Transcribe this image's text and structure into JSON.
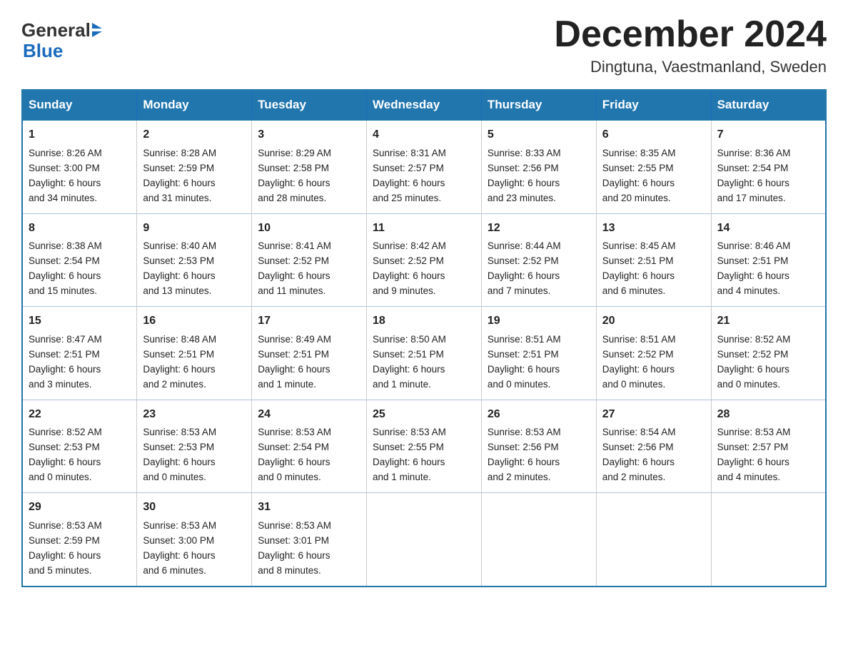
{
  "header": {
    "logo_general": "General",
    "logo_blue": "Blue",
    "month_title": "December 2024",
    "location": "Dingtuna, Vaestmanland, Sweden"
  },
  "columns": [
    "Sunday",
    "Monday",
    "Tuesday",
    "Wednesday",
    "Thursday",
    "Friday",
    "Saturday"
  ],
  "weeks": [
    [
      {
        "day": "1",
        "sunrise": "Sunrise: 8:26 AM",
        "sunset": "Sunset: 3:00 PM",
        "daylight": "Daylight: 6 hours",
        "daylight2": "and 34 minutes."
      },
      {
        "day": "2",
        "sunrise": "Sunrise: 8:28 AM",
        "sunset": "Sunset: 2:59 PM",
        "daylight": "Daylight: 6 hours",
        "daylight2": "and 31 minutes."
      },
      {
        "day": "3",
        "sunrise": "Sunrise: 8:29 AM",
        "sunset": "Sunset: 2:58 PM",
        "daylight": "Daylight: 6 hours",
        "daylight2": "and 28 minutes."
      },
      {
        "day": "4",
        "sunrise": "Sunrise: 8:31 AM",
        "sunset": "Sunset: 2:57 PM",
        "daylight": "Daylight: 6 hours",
        "daylight2": "and 25 minutes."
      },
      {
        "day": "5",
        "sunrise": "Sunrise: 8:33 AM",
        "sunset": "Sunset: 2:56 PM",
        "daylight": "Daylight: 6 hours",
        "daylight2": "and 23 minutes."
      },
      {
        "day": "6",
        "sunrise": "Sunrise: 8:35 AM",
        "sunset": "Sunset: 2:55 PM",
        "daylight": "Daylight: 6 hours",
        "daylight2": "and 20 minutes."
      },
      {
        "day": "7",
        "sunrise": "Sunrise: 8:36 AM",
        "sunset": "Sunset: 2:54 PM",
        "daylight": "Daylight: 6 hours",
        "daylight2": "and 17 minutes."
      }
    ],
    [
      {
        "day": "8",
        "sunrise": "Sunrise: 8:38 AM",
        "sunset": "Sunset: 2:54 PM",
        "daylight": "Daylight: 6 hours",
        "daylight2": "and 15 minutes."
      },
      {
        "day": "9",
        "sunrise": "Sunrise: 8:40 AM",
        "sunset": "Sunset: 2:53 PM",
        "daylight": "Daylight: 6 hours",
        "daylight2": "and 13 minutes."
      },
      {
        "day": "10",
        "sunrise": "Sunrise: 8:41 AM",
        "sunset": "Sunset: 2:52 PM",
        "daylight": "Daylight: 6 hours",
        "daylight2": "and 11 minutes."
      },
      {
        "day": "11",
        "sunrise": "Sunrise: 8:42 AM",
        "sunset": "Sunset: 2:52 PM",
        "daylight": "Daylight: 6 hours",
        "daylight2": "and 9 minutes."
      },
      {
        "day": "12",
        "sunrise": "Sunrise: 8:44 AM",
        "sunset": "Sunset: 2:52 PM",
        "daylight": "Daylight: 6 hours",
        "daylight2": "and 7 minutes."
      },
      {
        "day": "13",
        "sunrise": "Sunrise: 8:45 AM",
        "sunset": "Sunset: 2:51 PM",
        "daylight": "Daylight: 6 hours",
        "daylight2": "and 6 minutes."
      },
      {
        "day": "14",
        "sunrise": "Sunrise: 8:46 AM",
        "sunset": "Sunset: 2:51 PM",
        "daylight": "Daylight: 6 hours",
        "daylight2": "and 4 minutes."
      }
    ],
    [
      {
        "day": "15",
        "sunrise": "Sunrise: 8:47 AM",
        "sunset": "Sunset: 2:51 PM",
        "daylight": "Daylight: 6 hours",
        "daylight2": "and 3 minutes."
      },
      {
        "day": "16",
        "sunrise": "Sunrise: 8:48 AM",
        "sunset": "Sunset: 2:51 PM",
        "daylight": "Daylight: 6 hours",
        "daylight2": "and 2 minutes."
      },
      {
        "day": "17",
        "sunrise": "Sunrise: 8:49 AM",
        "sunset": "Sunset: 2:51 PM",
        "daylight": "Daylight: 6 hours",
        "daylight2": "and 1 minute."
      },
      {
        "day": "18",
        "sunrise": "Sunrise: 8:50 AM",
        "sunset": "Sunset: 2:51 PM",
        "daylight": "Daylight: 6 hours",
        "daylight2": "and 1 minute."
      },
      {
        "day": "19",
        "sunrise": "Sunrise: 8:51 AM",
        "sunset": "Sunset: 2:51 PM",
        "daylight": "Daylight: 6 hours",
        "daylight2": "and 0 minutes."
      },
      {
        "day": "20",
        "sunrise": "Sunrise: 8:51 AM",
        "sunset": "Sunset: 2:52 PM",
        "daylight": "Daylight: 6 hours",
        "daylight2": "and 0 minutes."
      },
      {
        "day": "21",
        "sunrise": "Sunrise: 8:52 AM",
        "sunset": "Sunset: 2:52 PM",
        "daylight": "Daylight: 6 hours",
        "daylight2": "and 0 minutes."
      }
    ],
    [
      {
        "day": "22",
        "sunrise": "Sunrise: 8:52 AM",
        "sunset": "Sunset: 2:53 PM",
        "daylight": "Daylight: 6 hours",
        "daylight2": "and 0 minutes."
      },
      {
        "day": "23",
        "sunrise": "Sunrise: 8:53 AM",
        "sunset": "Sunset: 2:53 PM",
        "daylight": "Daylight: 6 hours",
        "daylight2": "and 0 minutes."
      },
      {
        "day": "24",
        "sunrise": "Sunrise: 8:53 AM",
        "sunset": "Sunset: 2:54 PM",
        "daylight": "Daylight: 6 hours",
        "daylight2": "and 0 minutes."
      },
      {
        "day": "25",
        "sunrise": "Sunrise: 8:53 AM",
        "sunset": "Sunset: 2:55 PM",
        "daylight": "Daylight: 6 hours",
        "daylight2": "and 1 minute."
      },
      {
        "day": "26",
        "sunrise": "Sunrise: 8:53 AM",
        "sunset": "Sunset: 2:56 PM",
        "daylight": "Daylight: 6 hours",
        "daylight2": "and 2 minutes."
      },
      {
        "day": "27",
        "sunrise": "Sunrise: 8:54 AM",
        "sunset": "Sunset: 2:56 PM",
        "daylight": "Daylight: 6 hours",
        "daylight2": "and 2 minutes."
      },
      {
        "day": "28",
        "sunrise": "Sunrise: 8:53 AM",
        "sunset": "Sunset: 2:57 PM",
        "daylight": "Daylight: 6 hours",
        "daylight2": "and 4 minutes."
      }
    ],
    [
      {
        "day": "29",
        "sunrise": "Sunrise: 8:53 AM",
        "sunset": "Sunset: 2:59 PM",
        "daylight": "Daylight: 6 hours",
        "daylight2": "and 5 minutes."
      },
      {
        "day": "30",
        "sunrise": "Sunrise: 8:53 AM",
        "sunset": "Sunset: 3:00 PM",
        "daylight": "Daylight: 6 hours",
        "daylight2": "and 6 minutes."
      },
      {
        "day": "31",
        "sunrise": "Sunrise: 8:53 AM",
        "sunset": "Sunset: 3:01 PM",
        "daylight": "Daylight: 6 hours",
        "daylight2": "and 8 minutes."
      },
      {
        "day": "",
        "sunrise": "",
        "sunset": "",
        "daylight": "",
        "daylight2": ""
      },
      {
        "day": "",
        "sunrise": "",
        "sunset": "",
        "daylight": "",
        "daylight2": ""
      },
      {
        "day": "",
        "sunrise": "",
        "sunset": "",
        "daylight": "",
        "daylight2": ""
      },
      {
        "day": "",
        "sunrise": "",
        "sunset": "",
        "daylight": "",
        "daylight2": ""
      }
    ]
  ]
}
